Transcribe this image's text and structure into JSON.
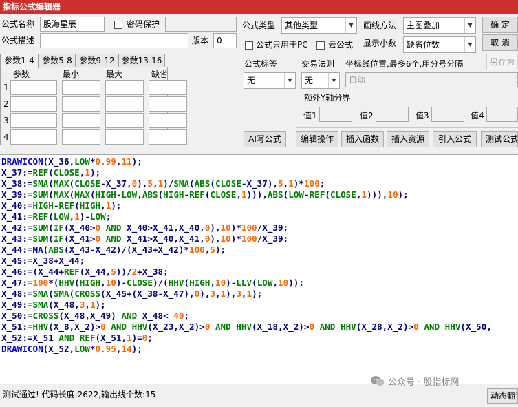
{
  "window": {
    "title": "指标公式编辑器"
  },
  "form": {
    "name_label": "公式名称",
    "name_value": "股海星辰",
    "password_label": "密码保护",
    "desc_label": "公式描述",
    "desc_value": "",
    "version_label": "版本",
    "version_value": "0",
    "type_label": "公式类型",
    "type_value": "其他类型",
    "draw_label": "画线方法",
    "draw_value": "主图叠加",
    "pc_only_label": "公式只用于PC",
    "cloud_label": "云公式",
    "decimals_label": "显示小数",
    "decimals_value": "缺省位数",
    "tag_label": "公式标签",
    "tag_value": "无",
    "trade_label": "交易法则",
    "trade_value": "无",
    "axis_label": "坐标线位置,最多6个,用分号分隔",
    "axis_value": "自动",
    "yaxis_group": "额外Y轴分界",
    "y1": "值1",
    "y2": "值2",
    "y3": "值3",
    "y4": "值4"
  },
  "buttons": {
    "ok": "确  定",
    "cancel": "取  消",
    "save_as": "另存为",
    "ai": "AI写公式",
    "edit_op": "编辑操作",
    "insert_func": "插入函数",
    "insert_res": "插入资源",
    "import": "引入公式",
    "test": "测试公式"
  },
  "tabs": [
    "参数1-4",
    "参数5-8",
    "参数9-12",
    "参数13-16"
  ],
  "params": {
    "headers": [
      "参数",
      "最小",
      "最大",
      "缺省"
    ],
    "rows": [
      "1",
      "2",
      "3",
      "4"
    ]
  },
  "colors": {
    "kw": "#0000cc",
    "fn": "#008000",
    "num": "#ff6600",
    "pl": "#000080"
  },
  "code": [
    [
      [
        "DRAWICON",
        "kw"
      ],
      [
        "(X_36,",
        "pl"
      ],
      [
        "LOW",
        "fn"
      ],
      [
        "*",
        "pl"
      ],
      [
        "0.99",
        "num"
      ],
      [
        ",",
        "pl"
      ],
      [
        "11",
        "num"
      ],
      [
        ");",
        "pl"
      ]
    ],
    [
      [
        "X_37:=",
        "pl"
      ],
      [
        "REF",
        "fn"
      ],
      [
        "(",
        "pl"
      ],
      [
        "CLOSE",
        "fn"
      ],
      [
        ",",
        "pl"
      ],
      [
        "1",
        "num"
      ],
      [
        ");",
        "pl"
      ]
    ],
    [
      [
        "X_38:=",
        "pl"
      ],
      [
        "SMA",
        "fn"
      ],
      [
        "(",
        "pl"
      ],
      [
        "MAX",
        "fn"
      ],
      [
        "(",
        "pl"
      ],
      [
        "CLOSE",
        "fn"
      ],
      [
        "-X_37,",
        "pl"
      ],
      [
        "0",
        "num"
      ],
      [
        "),",
        "pl"
      ],
      [
        "5",
        "num"
      ],
      [
        ",",
        "pl"
      ],
      [
        "1",
        "num"
      ],
      [
        ")/",
        "pl"
      ],
      [
        "SMA",
        "fn"
      ],
      [
        "(",
        "pl"
      ],
      [
        "ABS",
        "fn"
      ],
      [
        "(",
        "pl"
      ],
      [
        "CLOSE",
        "fn"
      ],
      [
        "-X_37),",
        "pl"
      ],
      [
        "5",
        "num"
      ],
      [
        ",",
        "pl"
      ],
      [
        "1",
        "num"
      ],
      [
        ")*",
        "pl"
      ],
      [
        "100",
        "num"
      ],
      [
        ";",
        "pl"
      ]
    ],
    [
      [
        "X_39:=",
        "pl"
      ],
      [
        "SUM",
        "fn"
      ],
      [
        "(",
        "pl"
      ],
      [
        "MAX",
        "fn"
      ],
      [
        "(",
        "pl"
      ],
      [
        "MAX",
        "fn"
      ],
      [
        "(",
        "pl"
      ],
      [
        "HIGH",
        "fn"
      ],
      [
        "-",
        "pl"
      ],
      [
        "LOW",
        "fn"
      ],
      [
        ",",
        "pl"
      ],
      [
        "ABS",
        "fn"
      ],
      [
        "(",
        "pl"
      ],
      [
        "HIGH",
        "fn"
      ],
      [
        "-",
        "pl"
      ],
      [
        "REF",
        "fn"
      ],
      [
        "(",
        "pl"
      ],
      [
        "CLOSE",
        "fn"
      ],
      [
        ",",
        "pl"
      ],
      [
        "1",
        "num"
      ],
      [
        "))),",
        "pl"
      ],
      [
        "ABS",
        "fn"
      ],
      [
        "(",
        "pl"
      ],
      [
        "LOW",
        "fn"
      ],
      [
        "-",
        "pl"
      ],
      [
        "REF",
        "fn"
      ],
      [
        "(",
        "pl"
      ],
      [
        "CLOSE",
        "fn"
      ],
      [
        ",",
        "pl"
      ],
      [
        "1",
        "num"
      ],
      [
        "))),",
        "pl"
      ],
      [
        "10",
        "num"
      ],
      [
        ");",
        "pl"
      ]
    ],
    [
      [
        "X_40:=",
        "pl"
      ],
      [
        "HIGH",
        "fn"
      ],
      [
        "-",
        "pl"
      ],
      [
        "REF",
        "fn"
      ],
      [
        "(",
        "pl"
      ],
      [
        "HIGH",
        "fn"
      ],
      [
        ",",
        "pl"
      ],
      [
        "1",
        "num"
      ],
      [
        ");",
        "pl"
      ]
    ],
    [
      [
        "X_41:=",
        "pl"
      ],
      [
        "REF",
        "fn"
      ],
      [
        "(",
        "pl"
      ],
      [
        "LOW",
        "fn"
      ],
      [
        ",",
        "pl"
      ],
      [
        "1",
        "num"
      ],
      [
        ")-",
        "pl"
      ],
      [
        "LOW",
        "fn"
      ],
      [
        ";",
        "pl"
      ]
    ],
    [
      [
        "X_42:=",
        "pl"
      ],
      [
        "SUM",
        "fn"
      ],
      [
        "(",
        "pl"
      ],
      [
        "IF",
        "fn"
      ],
      [
        "(X_40>",
        "pl"
      ],
      [
        "0",
        "num"
      ],
      [
        " ",
        "pl"
      ],
      [
        "AND",
        "fn"
      ],
      [
        " X_40>X_41,X_40,",
        "pl"
      ],
      [
        "0",
        "num"
      ],
      [
        "),",
        "pl"
      ],
      [
        "10",
        "num"
      ],
      [
        ")*",
        "pl"
      ],
      [
        "100",
        "num"
      ],
      [
        "/X_39;",
        "pl"
      ]
    ],
    [
      [
        "X_43:=",
        "pl"
      ],
      [
        "SUM",
        "fn"
      ],
      [
        "(",
        "pl"
      ],
      [
        "IF",
        "fn"
      ],
      [
        "(X_41>",
        "pl"
      ],
      [
        "0",
        "num"
      ],
      [
        " ",
        "pl"
      ],
      [
        "AND",
        "fn"
      ],
      [
        " X_41>X_40,X_41,",
        "pl"
      ],
      [
        "0",
        "num"
      ],
      [
        "),",
        "pl"
      ],
      [
        "10",
        "num"
      ],
      [
        ")*",
        "pl"
      ],
      [
        "100",
        "num"
      ],
      [
        "/X_39;",
        "pl"
      ]
    ],
    [
      [
        "X_44:=",
        "pl"
      ],
      [
        "MA",
        "kw"
      ],
      [
        "(",
        "pl"
      ],
      [
        "ABS",
        "fn"
      ],
      [
        "(X_43-X_42)/(X_43+X_42)*",
        "pl"
      ],
      [
        "100",
        "num"
      ],
      [
        ",",
        "pl"
      ],
      [
        "5",
        "num"
      ],
      [
        ");",
        "pl"
      ]
    ],
    [
      [
        "X_45:=X_38+X_44;",
        "pl"
      ]
    ],
    [
      [
        "X_46:=(X_44+",
        "pl"
      ],
      [
        "REF",
        "fn"
      ],
      [
        "(X_44,",
        "pl"
      ],
      [
        "5",
        "num"
      ],
      [
        "))/",
        "pl"
      ],
      [
        "2",
        "num"
      ],
      [
        "+X_38;",
        "pl"
      ]
    ],
    [
      [
        "X_47:=",
        "pl"
      ],
      [
        "100",
        "num"
      ],
      [
        "*(",
        "pl"
      ],
      [
        "HHV",
        "fn"
      ],
      [
        "(",
        "pl"
      ],
      [
        "HIGH",
        "fn"
      ],
      [
        ",",
        "pl"
      ],
      [
        "10",
        "num"
      ],
      [
        ")-",
        "pl"
      ],
      [
        "CLOSE",
        "fn"
      ],
      [
        ")/(",
        "pl"
      ],
      [
        "HHV",
        "fn"
      ],
      [
        "(",
        "pl"
      ],
      [
        "HIGH",
        "fn"
      ],
      [
        ",",
        "pl"
      ],
      [
        "10",
        "num"
      ],
      [
        ")-",
        "pl"
      ],
      [
        "LLV",
        "fn"
      ],
      [
        "(",
        "pl"
      ],
      [
        "LOW",
        "fn"
      ],
      [
        ",",
        "pl"
      ],
      [
        "10",
        "num"
      ],
      [
        "));",
        "pl"
      ]
    ],
    [
      [
        "X_48:=",
        "pl"
      ],
      [
        "SMA",
        "fn"
      ],
      [
        "(",
        "pl"
      ],
      [
        "SMA",
        "fn"
      ],
      [
        "(",
        "pl"
      ],
      [
        "CROSS",
        "fn"
      ],
      [
        "(X_45+(X_38-X_47),",
        "pl"
      ],
      [
        "0",
        "num"
      ],
      [
        "),",
        "pl"
      ],
      [
        "3",
        "num"
      ],
      [
        ",",
        "pl"
      ],
      [
        "1",
        "num"
      ],
      [
        "),",
        "pl"
      ],
      [
        "3",
        "num"
      ],
      [
        ",",
        "pl"
      ],
      [
        "1",
        "num"
      ],
      [
        ");",
        "pl"
      ]
    ],
    [
      [
        "X_49:=",
        "pl"
      ],
      [
        "SMA",
        "fn"
      ],
      [
        "(X_48,",
        "pl"
      ],
      [
        "3",
        "num"
      ],
      [
        ",",
        "pl"
      ],
      [
        "1",
        "num"
      ],
      [
        ");",
        "pl"
      ]
    ],
    [
      [
        "X_50:=",
        "pl"
      ],
      [
        "CROSS",
        "fn"
      ],
      [
        "(X_48,X_49) ",
        "pl"
      ],
      [
        "AND",
        "fn"
      ],
      [
        " X_48< ",
        "pl"
      ],
      [
        "40",
        "num"
      ],
      [
        ";",
        "pl"
      ]
    ],
    [
      [
        "X_51:=",
        "pl"
      ],
      [
        "HHV",
        "fn"
      ],
      [
        "(X_8,X_2)>",
        "pl"
      ],
      [
        "0",
        "num"
      ],
      [
        " ",
        "pl"
      ],
      [
        "AND",
        "fn"
      ],
      [
        " ",
        "pl"
      ],
      [
        "HHV",
        "fn"
      ],
      [
        "(X_23,X_2)>",
        "pl"
      ],
      [
        "0",
        "num"
      ],
      [
        " ",
        "pl"
      ],
      [
        "AND",
        "fn"
      ],
      [
        " ",
        "pl"
      ],
      [
        "HHV",
        "fn"
      ],
      [
        "(X_18,X_2)>",
        "pl"
      ],
      [
        "0",
        "num"
      ],
      [
        " ",
        "pl"
      ],
      [
        "AND",
        "fn"
      ],
      [
        " ",
        "pl"
      ],
      [
        "HHV",
        "fn"
      ],
      [
        "(X_28,X_2)>",
        "pl"
      ],
      [
        "0",
        "num"
      ],
      [
        " ",
        "pl"
      ],
      [
        "AND",
        "fn"
      ],
      [
        " ",
        "pl"
      ],
      [
        "HHV",
        "fn"
      ],
      [
        "(X_50,",
        "pl"
      ]
    ],
    [
      [
        "X_52:=X_51 ",
        "pl"
      ],
      [
        "AND",
        "fn"
      ],
      [
        " ",
        "pl"
      ],
      [
        "REF",
        "fn"
      ],
      [
        "(X_51,",
        "pl"
      ],
      [
        "1",
        "num"
      ],
      [
        ")=",
        "pl"
      ],
      [
        "0",
        "num"
      ],
      [
        ";",
        "pl"
      ]
    ],
    [
      [
        "DRAWICON",
        "kw"
      ],
      [
        "(X_52,",
        "pl"
      ],
      [
        "LOW",
        "fn"
      ],
      [
        "*",
        "pl"
      ],
      [
        "0.95",
        "num"
      ],
      [
        ",",
        "pl"
      ],
      [
        "14",
        "num"
      ],
      [
        ");",
        "pl"
      ]
    ]
  ],
  "status": {
    "text": "测试通过! 代码长度:2622,输出线个数:15",
    "watermark": "公众号 · 股指标网",
    "translate": "动态翻译"
  }
}
